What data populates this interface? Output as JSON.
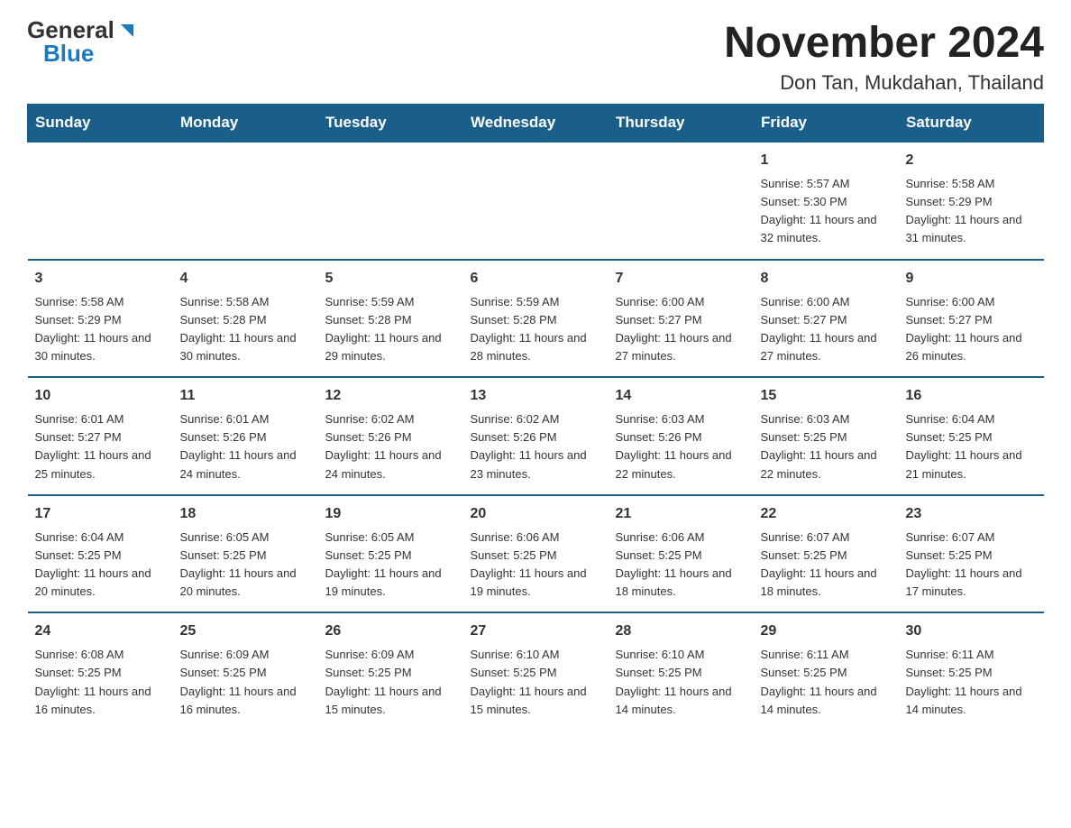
{
  "logo": {
    "general": "General",
    "blue": "Blue",
    "icon": "▶"
  },
  "title": "November 2024",
  "subtitle": "Don Tan, Mukdahan, Thailand",
  "days_of_week": [
    "Sunday",
    "Monday",
    "Tuesday",
    "Wednesday",
    "Thursday",
    "Friday",
    "Saturday"
  ],
  "weeks": [
    [
      null,
      null,
      null,
      null,
      null,
      {
        "date": "1",
        "sunrise": "5:57 AM",
        "sunset": "5:30 PM",
        "daylight": "11 hours and 32 minutes."
      },
      {
        "date": "2",
        "sunrise": "5:58 AM",
        "sunset": "5:29 PM",
        "daylight": "11 hours and 31 minutes."
      }
    ],
    [
      {
        "date": "3",
        "sunrise": "5:58 AM",
        "sunset": "5:29 PM",
        "daylight": "11 hours and 30 minutes."
      },
      {
        "date": "4",
        "sunrise": "5:58 AM",
        "sunset": "5:28 PM",
        "daylight": "11 hours and 30 minutes."
      },
      {
        "date": "5",
        "sunrise": "5:59 AM",
        "sunset": "5:28 PM",
        "daylight": "11 hours and 29 minutes."
      },
      {
        "date": "6",
        "sunrise": "5:59 AM",
        "sunset": "5:28 PM",
        "daylight": "11 hours and 28 minutes."
      },
      {
        "date": "7",
        "sunrise": "6:00 AM",
        "sunset": "5:27 PM",
        "daylight": "11 hours and 27 minutes."
      },
      {
        "date": "8",
        "sunrise": "6:00 AM",
        "sunset": "5:27 PM",
        "daylight": "11 hours and 27 minutes."
      },
      {
        "date": "9",
        "sunrise": "6:00 AM",
        "sunset": "5:27 PM",
        "daylight": "11 hours and 26 minutes."
      }
    ],
    [
      {
        "date": "10",
        "sunrise": "6:01 AM",
        "sunset": "5:27 PM",
        "daylight": "11 hours and 25 minutes."
      },
      {
        "date": "11",
        "sunrise": "6:01 AM",
        "sunset": "5:26 PM",
        "daylight": "11 hours and 24 minutes."
      },
      {
        "date": "12",
        "sunrise": "6:02 AM",
        "sunset": "5:26 PM",
        "daylight": "11 hours and 24 minutes."
      },
      {
        "date": "13",
        "sunrise": "6:02 AM",
        "sunset": "5:26 PM",
        "daylight": "11 hours and 23 minutes."
      },
      {
        "date": "14",
        "sunrise": "6:03 AM",
        "sunset": "5:26 PM",
        "daylight": "11 hours and 22 minutes."
      },
      {
        "date": "15",
        "sunrise": "6:03 AM",
        "sunset": "5:25 PM",
        "daylight": "11 hours and 22 minutes."
      },
      {
        "date": "16",
        "sunrise": "6:04 AM",
        "sunset": "5:25 PM",
        "daylight": "11 hours and 21 minutes."
      }
    ],
    [
      {
        "date": "17",
        "sunrise": "6:04 AM",
        "sunset": "5:25 PM",
        "daylight": "11 hours and 20 minutes."
      },
      {
        "date": "18",
        "sunrise": "6:05 AM",
        "sunset": "5:25 PM",
        "daylight": "11 hours and 20 minutes."
      },
      {
        "date": "19",
        "sunrise": "6:05 AM",
        "sunset": "5:25 PM",
        "daylight": "11 hours and 19 minutes."
      },
      {
        "date": "20",
        "sunrise": "6:06 AM",
        "sunset": "5:25 PM",
        "daylight": "11 hours and 19 minutes."
      },
      {
        "date": "21",
        "sunrise": "6:06 AM",
        "sunset": "5:25 PM",
        "daylight": "11 hours and 18 minutes."
      },
      {
        "date": "22",
        "sunrise": "6:07 AM",
        "sunset": "5:25 PM",
        "daylight": "11 hours and 18 minutes."
      },
      {
        "date": "23",
        "sunrise": "6:07 AM",
        "sunset": "5:25 PM",
        "daylight": "11 hours and 17 minutes."
      }
    ],
    [
      {
        "date": "24",
        "sunrise": "6:08 AM",
        "sunset": "5:25 PM",
        "daylight": "11 hours and 16 minutes."
      },
      {
        "date": "25",
        "sunrise": "6:09 AM",
        "sunset": "5:25 PM",
        "daylight": "11 hours and 16 minutes."
      },
      {
        "date": "26",
        "sunrise": "6:09 AM",
        "sunset": "5:25 PM",
        "daylight": "11 hours and 15 minutes."
      },
      {
        "date": "27",
        "sunrise": "6:10 AM",
        "sunset": "5:25 PM",
        "daylight": "11 hours and 15 minutes."
      },
      {
        "date": "28",
        "sunrise": "6:10 AM",
        "sunset": "5:25 PM",
        "daylight": "11 hours and 14 minutes."
      },
      {
        "date": "29",
        "sunrise": "6:11 AM",
        "sunset": "5:25 PM",
        "daylight": "11 hours and 14 minutes."
      },
      {
        "date": "30",
        "sunrise": "6:11 AM",
        "sunset": "5:25 PM",
        "daylight": "11 hours and 14 minutes."
      }
    ]
  ]
}
